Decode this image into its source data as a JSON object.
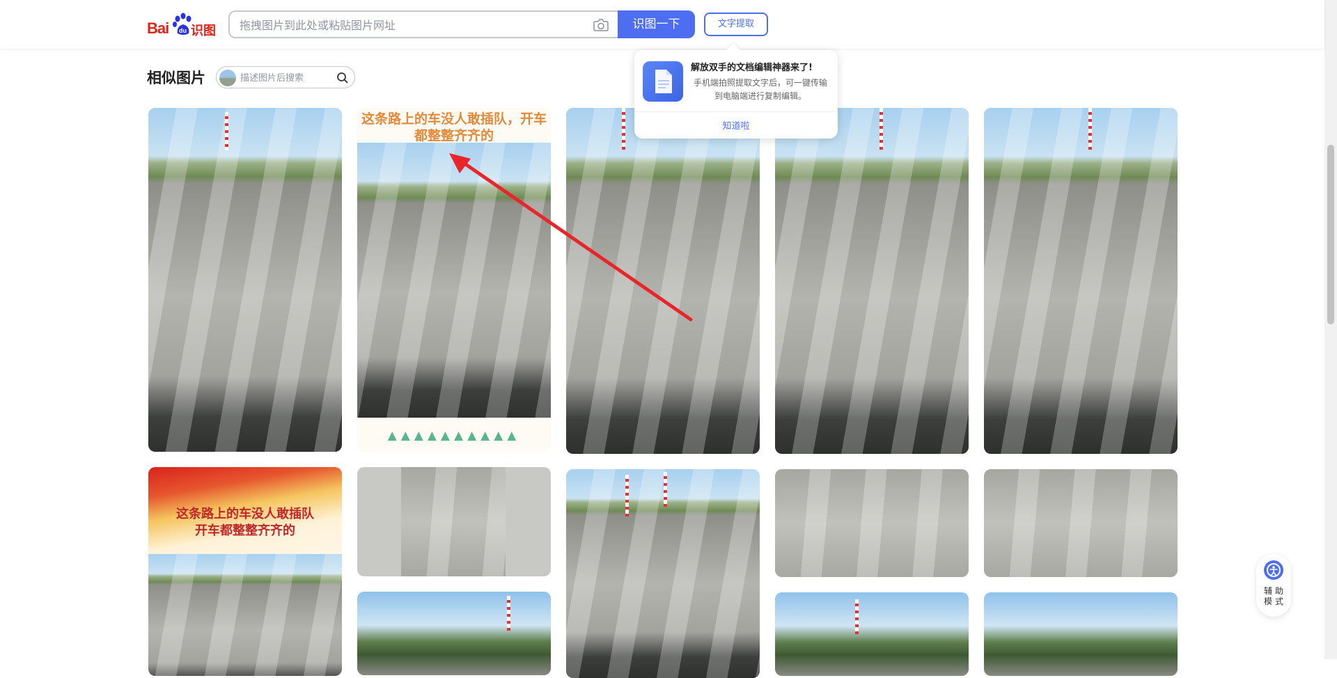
{
  "header": {
    "logo_text_1": "Bai",
    "logo_text_2": "识图",
    "search_placeholder": "拖拽图片到此处或粘贴图片网址",
    "search_button": "识图一下",
    "text_extract_button": "文字提取"
  },
  "popup": {
    "title": "解放双手的文档编辑神器来了!",
    "description": "手机端拍照提取文字后，可一键传输到电脑端进行复制编辑。",
    "confirm": "知道啦"
  },
  "section": {
    "title": "相似图片",
    "describe_placeholder": "描述图片后搜索"
  },
  "thumbnails": {
    "caption_2": "这条路上的车没人敢插队，开车都整整齐齐的",
    "caption_6": "这条路上的车没人敢插队\n开车都整整齐齐的"
  },
  "assist": {
    "label": "辅助模式"
  },
  "colors": {
    "brand_blue": "#4e6ef2",
    "logo_red": "#e2231a",
    "arrow_red": "#e8262a"
  }
}
